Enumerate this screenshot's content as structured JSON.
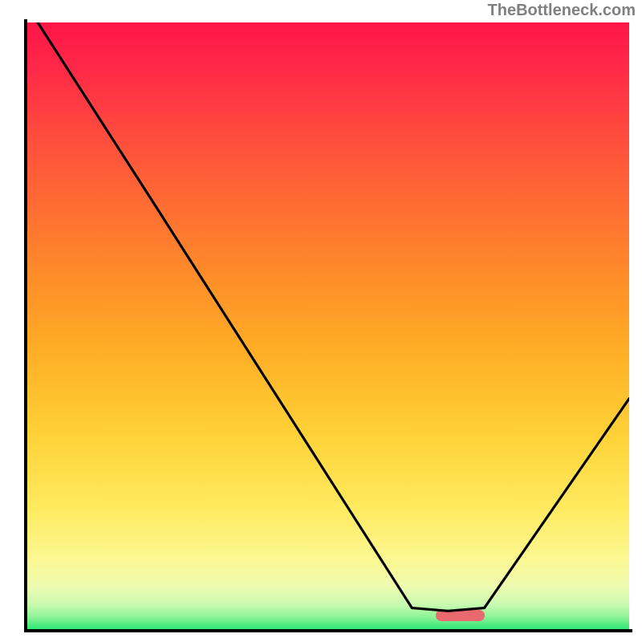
{
  "attribution": "TheBottleneck.com",
  "chart_data": {
    "type": "line",
    "title": "",
    "xlabel": "",
    "ylabel": "",
    "xlim": [
      0,
      100
    ],
    "ylim": [
      0,
      100
    ],
    "curve": [
      {
        "x": 2,
        "y": 100
      },
      {
        "x": 22,
        "y": 69
      },
      {
        "x": 64,
        "y": 3.5
      },
      {
        "x": 70,
        "y": 3
      },
      {
        "x": 76,
        "y": 3.5
      },
      {
        "x": 100,
        "y": 38
      }
    ],
    "marker": {
      "x_start": 68,
      "x_end": 76,
      "y": 2.2
    },
    "gradient_bands": [
      {
        "color": "#ff1f4b"
      },
      {
        "color": "#ff2e46"
      },
      {
        "color": "#ff3e41"
      },
      {
        "color": "#ff4e3c"
      },
      {
        "color": "#ff5e37"
      },
      {
        "color": "#ff6d32"
      },
      {
        "color": "#ff7d2d"
      },
      {
        "color": "#ff8d29"
      },
      {
        "color": "#ff9c26"
      },
      {
        "color": "#ffab26"
      },
      {
        "color": "#ffba2a"
      },
      {
        "color": "#ffc832"
      },
      {
        "color": "#ffd53e"
      },
      {
        "color": "#ffe14f"
      },
      {
        "color": "#ffeb63"
      },
      {
        "color": "#fff37c"
      },
      {
        "color": "#fdf896"
      },
      {
        "color": "#f3fbae"
      },
      {
        "color": "#defbb8"
      },
      {
        "color": "#b4f8ac"
      },
      {
        "color": "#54ea86"
      }
    ]
  }
}
